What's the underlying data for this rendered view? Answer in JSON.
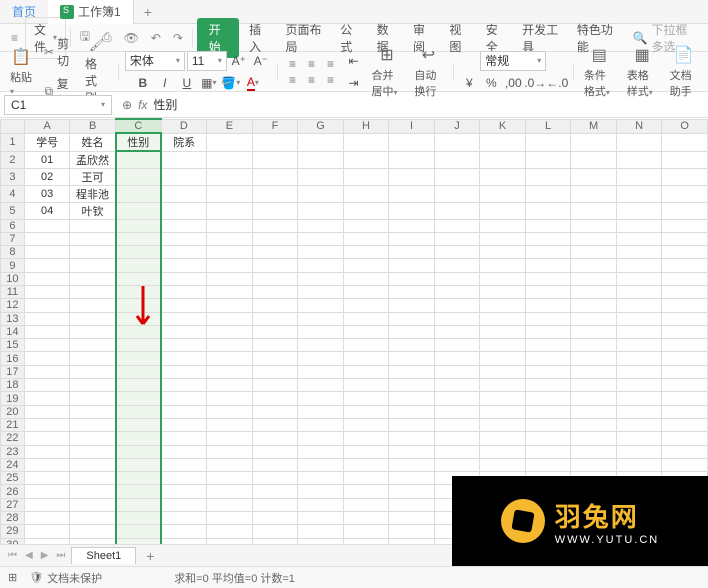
{
  "tabs": {
    "home": "首页",
    "workbook": "工作簿1"
  },
  "menu": {
    "file": "文件",
    "start": "开始",
    "insert": "插入",
    "layout": "页面布局",
    "formula": "公式",
    "data": "数据",
    "review": "审阅",
    "view": "视图",
    "security": "安全",
    "dev": "开发工具",
    "special": "特色功能",
    "search_ph": "下拉框多选"
  },
  "toolbar": {
    "paste": "粘贴",
    "cut": "剪切",
    "copy": "复制",
    "format_painter": "格式刷",
    "font": "宋体",
    "size": "11",
    "merge": "合并居中",
    "wrap": "自动换行",
    "numfmt": "常规",
    "cond": "条件格式",
    "tablestyle": "表格样式",
    "dochelp": "文档助手"
  },
  "cellref": {
    "name": "C1",
    "value": "性别"
  },
  "columns": [
    "A",
    "B",
    "C",
    "D",
    "E",
    "F",
    "G",
    "H",
    "I",
    "J",
    "K",
    "L",
    "M",
    "N",
    "O"
  ],
  "rows": [
    {
      "n": "1",
      "A": "学号",
      "B": "姓名",
      "C": "性别",
      "D": "院系"
    },
    {
      "n": "2",
      "A": "01",
      "B": "孟欣然",
      "C": "",
      "D": ""
    },
    {
      "n": "3",
      "A": "02",
      "B": "王可",
      "C": "",
      "D": ""
    },
    {
      "n": "4",
      "A": "03",
      "B": "程非池",
      "C": "",
      "D": ""
    },
    {
      "n": "5",
      "A": "04",
      "B": "叶钦",
      "C": "",
      "D": ""
    }
  ],
  "sheet": {
    "name": "Sheet1"
  },
  "status": {
    "protect": "文档未保护",
    "summary": "求和=0 平均值=0 计数=1"
  },
  "watermark": {
    "cn": "羽兔网",
    "url": "WWW.YUTU.CN"
  },
  "colors": {
    "accent": "#2e9e5b",
    "wm_bg": "#000",
    "wm_fg": "#f5b82e"
  },
  "chart_data": null
}
